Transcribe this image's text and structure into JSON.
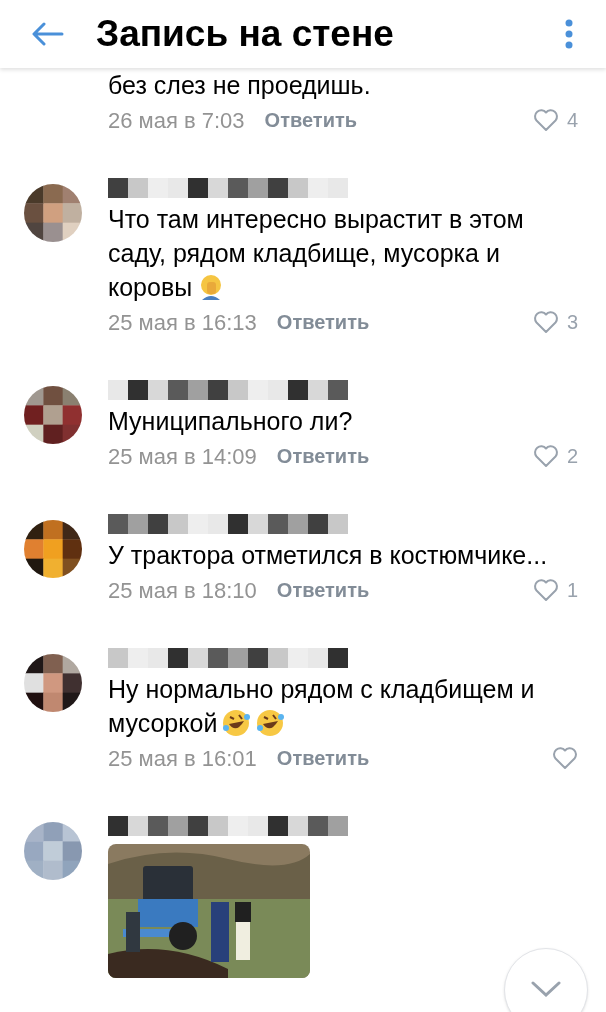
{
  "header": {
    "title": "Запись на стене"
  },
  "comments": [
    {
      "text": "без слез не проедишь.",
      "date": "26 мая в 7:03",
      "reply": "Ответить",
      "likes": "4",
      "kind": "continued"
    },
    {
      "text": "Что там интересно вырастит в этом саду, рядом кладбище, мусорка и коровы",
      "emojis": [
        {
          "kind": "facepalm"
        }
      ],
      "date": "25 мая в 16:13",
      "reply": "Ответить",
      "likes": "3",
      "kind": "full"
    },
    {
      "text": "Муниципального ли?",
      "date": "25 мая в 14:09",
      "reply": "Ответить",
      "likes": "2",
      "kind": "full"
    },
    {
      "text": "У трактора отметился в костюмчике...",
      "date": "25 мая в 18:10",
      "reply": "Ответить",
      "likes": "1",
      "kind": "full"
    },
    {
      "text": "Ну нормально рядом с кладбищем и мусоркой",
      "emojis": [
        {
          "kind": "laugh"
        },
        {
          "kind": "laugh"
        }
      ],
      "date": "25 мая в 16:01",
      "reply": "Ответить",
      "kind": "full"
    },
    {
      "kind": "full"
    }
  ]
}
